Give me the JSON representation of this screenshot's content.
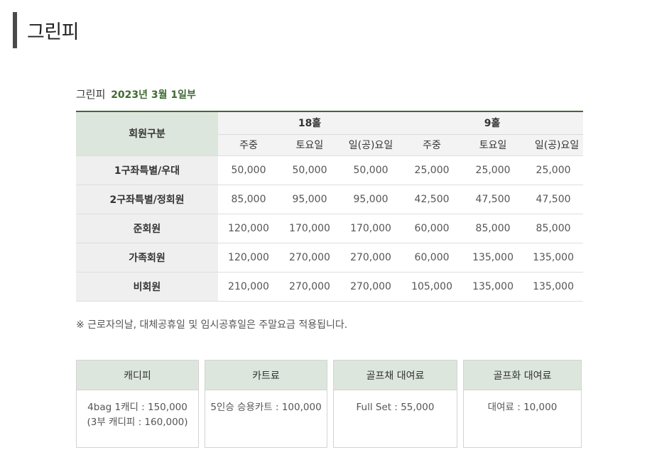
{
  "header": {
    "title": "그린피"
  },
  "subtitle": {
    "label": "그린피",
    "date": "2023년 3월 1일부"
  },
  "table": {
    "group_header": "회원구분",
    "halves": [
      "18홀",
      "9홀"
    ],
    "days": [
      "주중",
      "토요일",
      "일(공)요일",
      "주중",
      "토요일",
      "일(공)요일"
    ],
    "rows": [
      {
        "label": "1구좌특별/우대",
        "values": [
          "50,000",
          "50,000",
          "50,000",
          "25,000",
          "25,000",
          "25,000"
        ]
      },
      {
        "label": "2구좌특별/정회원",
        "values": [
          "85,000",
          "95,000",
          "95,000",
          "42,500",
          "47,500",
          "47,500"
        ]
      },
      {
        "label": "준회원",
        "values": [
          "120,000",
          "170,000",
          "170,000",
          "60,000",
          "85,000",
          "85,000"
        ]
      },
      {
        "label": "가족회원",
        "values": [
          "120,000",
          "270,000",
          "270,000",
          "60,000",
          "135,000",
          "135,000"
        ]
      },
      {
        "label": "비회원",
        "values": [
          "210,000",
          "270,000",
          "270,000",
          "105,000",
          "135,000",
          "135,000"
        ]
      }
    ]
  },
  "note": "※ 근로자의날, 대체공휴일 및 임시공휴일은 주말요금 적용됩니다.",
  "boxes": [
    {
      "title": "캐디피",
      "lines": [
        "4bag 1캐디 : 150,000",
        "(3부 캐디피 : 160,000)"
      ]
    },
    {
      "title": "카트료",
      "lines": [
        "5인승 승용카트 : 100,000"
      ]
    },
    {
      "title": "골프채 대여료",
      "lines": [
        "Full Set : 55,000"
      ]
    },
    {
      "title": "골프화 대여료",
      "lines": [
        "대여료 : 10,000"
      ]
    }
  ],
  "colors": {
    "accent_green": "#3f6b33",
    "header_bg": "#dde6dc",
    "row_label_bg": "#efefef"
  }
}
